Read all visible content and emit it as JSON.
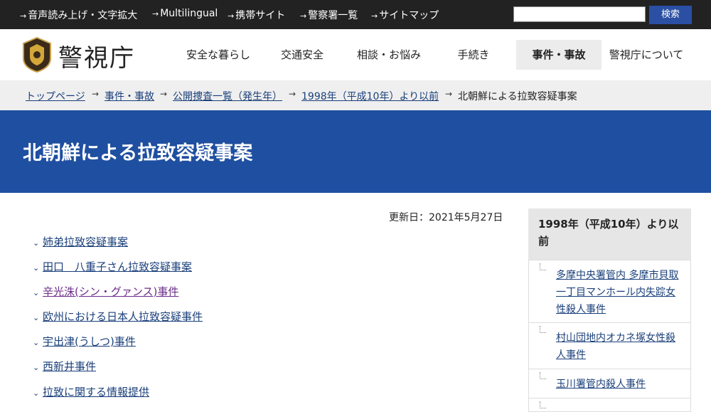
{
  "topbar": {
    "links": [
      {
        "label": "音声読み上げ・文字拡大"
      },
      {
        "label": "Multilingual"
      },
      {
        "label": "携帯サイト"
      },
      {
        "label": "警察署一覧"
      },
      {
        "label": "サイトマップ"
      }
    ],
    "arrow": "→",
    "search_value": "",
    "search_button": "検索"
  },
  "header": {
    "logo_text": "警視庁",
    "nav": [
      {
        "label": "安全な暮らし"
      },
      {
        "label": "交通安全"
      },
      {
        "label": "相談・お悩み"
      },
      {
        "label": "手続き"
      },
      {
        "label": "事件・事故",
        "active": true
      },
      {
        "label": "警視庁について"
      }
    ]
  },
  "breadcrumb": {
    "items": [
      {
        "label": "トップページ"
      },
      {
        "label": "事件・事故"
      },
      {
        "label": "公開捜査一覧（発生年）"
      },
      {
        "label": "1998年（平成10年）より以前"
      },
      {
        "label": "北朝鮮による拉致容疑事案"
      }
    ],
    "separator": "→"
  },
  "page": {
    "title": "北朝鮮による拉致容疑事案",
    "updated": "更新日：2021年5月27日"
  },
  "main_list": [
    {
      "label": "姉弟拉致容疑事案"
    },
    {
      "label": "田口　八重子さん拉致容疑事案"
    },
    {
      "label": "辛光洙(シン・グァンス)事件",
      "visited": true
    },
    {
      "label": "欧州における日本人拉致容疑事件"
    },
    {
      "label": "宇出津(うしつ)事件"
    },
    {
      "label": "西新井事件"
    },
    {
      "label": "拉致に関する情報提供"
    }
  ],
  "sidebar": {
    "heading": "1998年（平成10年）より以前",
    "links": [
      {
        "label": "多摩中央署管内 多摩市貝取一丁目マンホール内失踪女性殺人事件"
      },
      {
        "label": "村山団地内オカネ塚女性殺人事件"
      },
      {
        "label": "玉川署管内殺人事件"
      }
    ]
  },
  "colors": {
    "topbar": "#222222",
    "title_band": "#1f4fa0",
    "link": "#1a3f7a",
    "visited_link": "#6b2b88"
  }
}
